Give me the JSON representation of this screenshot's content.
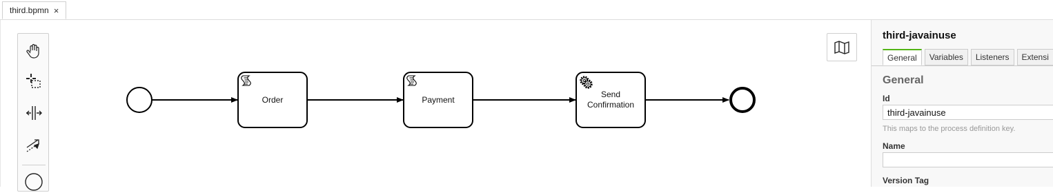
{
  "tab": {
    "label": "third.bpmn",
    "close": "×"
  },
  "diagram": {
    "tasks": [
      {
        "label": "Order",
        "type": "script"
      },
      {
        "label": "Payment",
        "type": "script"
      },
      {
        "label": "Send Confirmation",
        "type": "service"
      }
    ]
  },
  "panel": {
    "title": "third-javainuse",
    "tabs": [
      "General",
      "Variables",
      "Listeners",
      "Extensi"
    ],
    "active_tab": "General",
    "section": "General",
    "id_label": "Id",
    "id_value": "third-javainuse",
    "id_hint": "This maps to the process definition key.",
    "name_label": "Name",
    "name_value": "",
    "version_label": "Version Tag"
  },
  "colors": {
    "accent": "#52b415",
    "stroke": "#000000"
  }
}
